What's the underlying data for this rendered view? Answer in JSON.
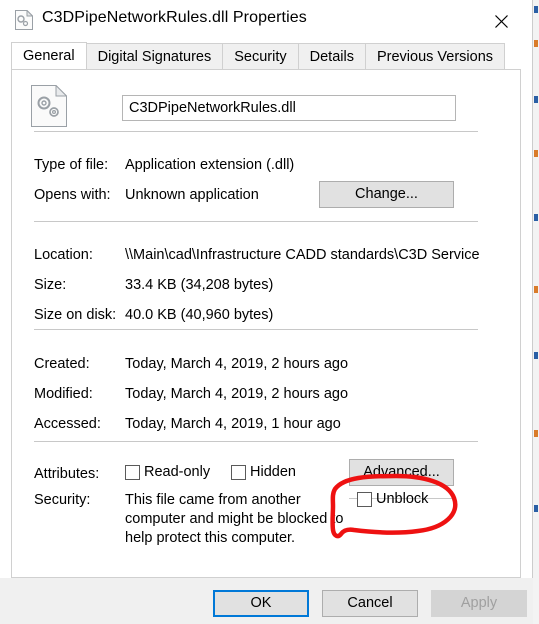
{
  "window": {
    "title": "C3DPipeNetworkRules.dll Properties",
    "icon": "dll-file-icon",
    "close_label": "✕"
  },
  "tabs": [
    {
      "label": "General",
      "active": true
    },
    {
      "label": "Digital Signatures",
      "active": false
    },
    {
      "label": "Security",
      "active": false
    },
    {
      "label": "Details",
      "active": false
    },
    {
      "label": "Previous Versions",
      "active": false
    }
  ],
  "file_header": {
    "icon": "dll-gear-document-icon",
    "name_value": "C3DPipeNetworkRules.dll",
    "name_placeholder": "File name"
  },
  "properties": [
    {
      "label": "Type of file:",
      "value": "Application extension (.dll)"
    },
    {
      "label": "Opens with:",
      "value": "Unknown application"
    },
    {
      "label": "Location:",
      "value": "\\\\Main\\cad\\Infrastructure CADD standards\\C3D Service"
    },
    {
      "label": "Size:",
      "value": "33.4 KB (34,208 bytes)"
    },
    {
      "label": "Size on disk:",
      "value": "40.0 KB (40,960 bytes)"
    },
    {
      "label": "Created:",
      "value": "Today, March 4, 2019, 2 hours ago"
    },
    {
      "label": "Modified:",
      "value": "Today, March 4, 2019, 2 hours ago"
    },
    {
      "label": "Accessed:",
      "value": "Today, March 4, 2019, 1 hour ago"
    }
  ],
  "change_button": {
    "label": "Change..."
  },
  "attributes": {
    "label": "Attributes:",
    "readonly": {
      "label": "Read-only",
      "checked": false
    },
    "hidden": {
      "label": "Hidden",
      "checked": false
    },
    "advanced_button": {
      "label": "Advanced..."
    }
  },
  "security": {
    "label": "Security:",
    "description": "This file came from another computer and might be blocked to help protect this computer.",
    "unblock": {
      "label": "Unblock",
      "checked": false
    }
  },
  "footer": {
    "ok": "OK",
    "cancel": "Cancel",
    "apply": "Apply"
  },
  "annotation": {
    "shape": "hand-drawn-red-circle",
    "color": "#ee1111",
    "target": "unblock-checkbox"
  },
  "colors": {
    "accent": "#0078d7",
    "annotation": "#ee1111",
    "panel_bg": "#ffffff",
    "chrome_bg": "#f0f0f0",
    "button_face": "#e1e1e1",
    "disabled_text": "#a0a0a0"
  }
}
